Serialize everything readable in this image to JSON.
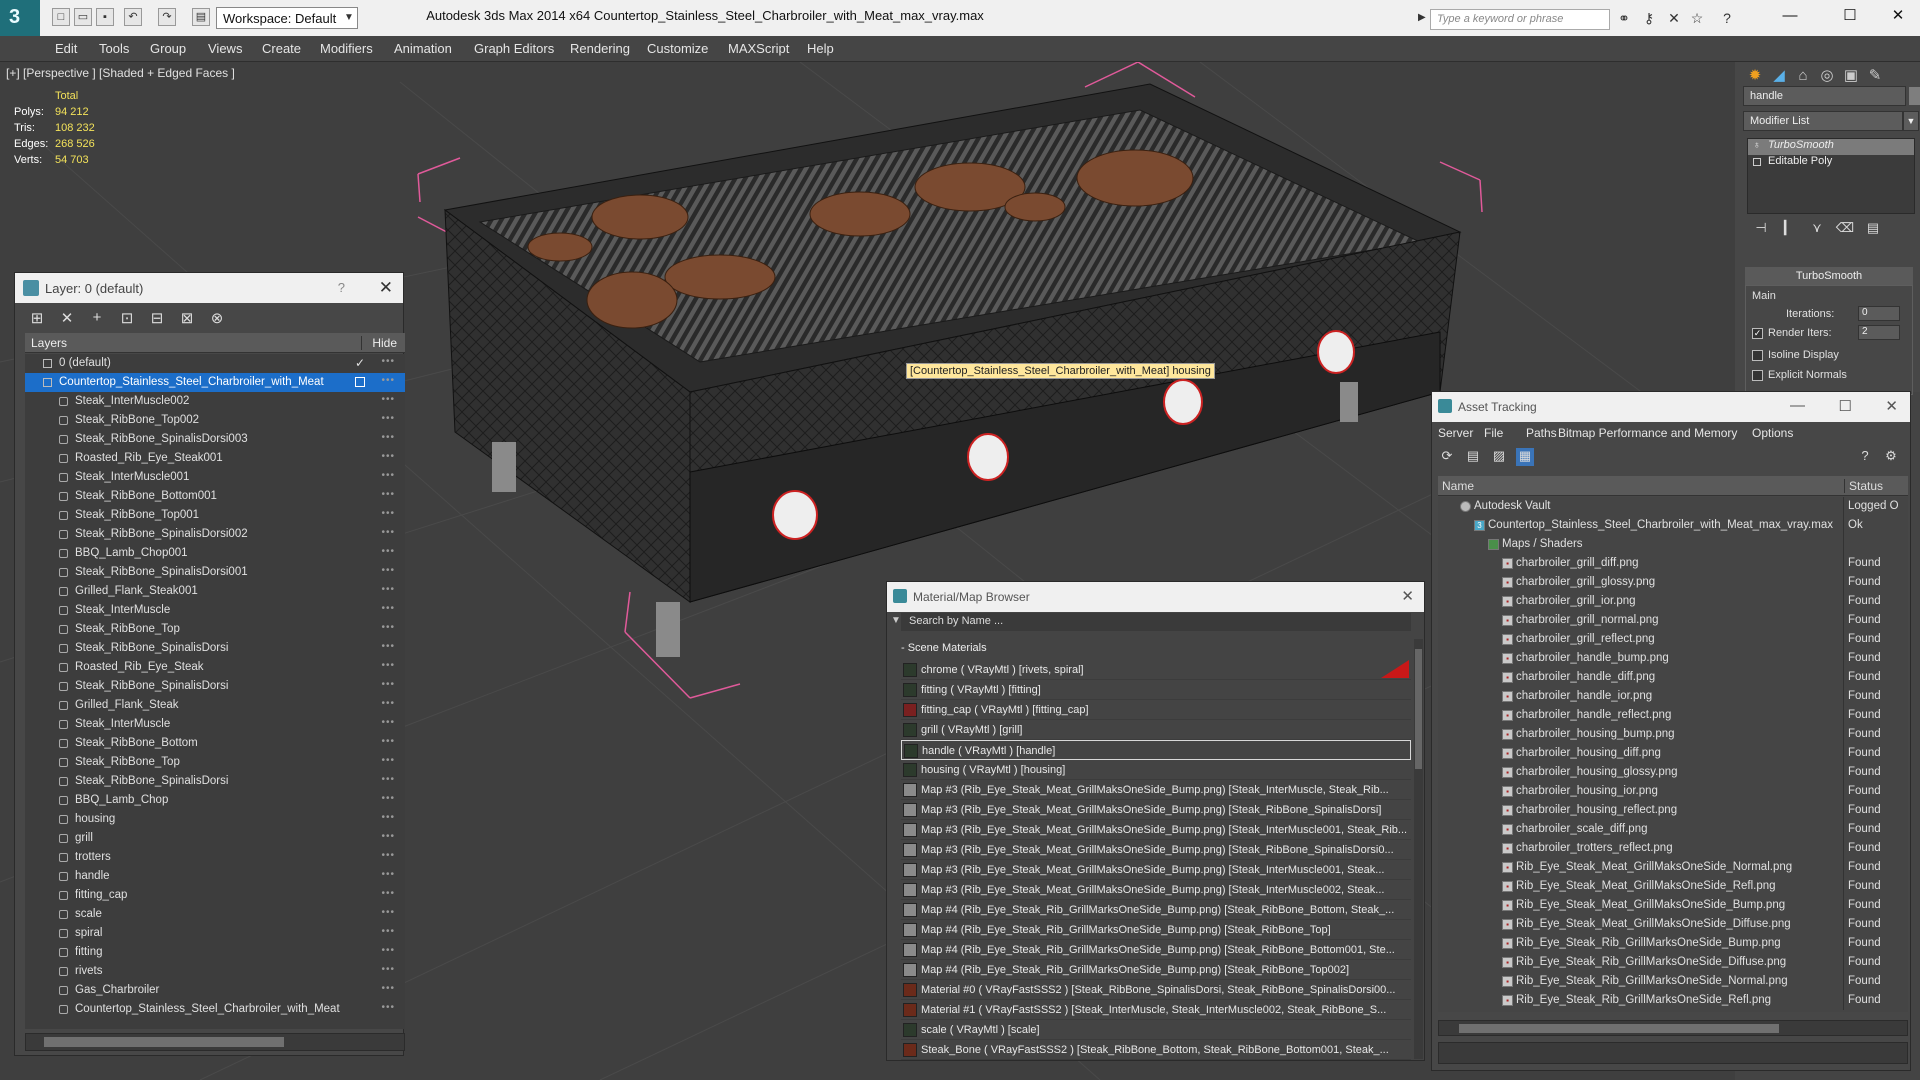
{
  "app": {
    "title": "Autodesk 3ds Max  2014 x64     Countertop_Stainless_Steel_Charbroiler_with_Meat_max_vray.max",
    "logo": "3",
    "workspace": "Workspace: Default",
    "search_placeholder": "Type a keyword or phrase",
    "win_minimize": "—",
    "win_maximize": "☐",
    "win_close": "✕"
  },
  "menu": [
    "Edit",
    "Tools",
    "Group",
    "Views",
    "Create",
    "Modifiers",
    "Animation",
    "Graph Editors",
    "Rendering",
    "Customize",
    "MAXScript",
    "Help"
  ],
  "viewport": {
    "label": "[+] [Perspective ] [Shaded + Edged Faces ]",
    "stats": {
      "header": "Total",
      "rows": [
        {
          "label": "Polys:",
          "value": "94 212"
        },
        {
          "label": "Tris:",
          "value": "108 232"
        },
        {
          "label": "Edges:",
          "value": "268 526"
        },
        {
          "label": "Verts:",
          "value": "54 703"
        }
      ]
    },
    "tooltip": "[Countertop_Stainless_Steel_Charbroiler_with_Meat] housing"
  },
  "layer_window": {
    "title": "Layer: 0 (default)",
    "help": "?",
    "close": "✕",
    "col_layers": "Layers",
    "col_hide": "Hide",
    "root": "0 (default)",
    "selected": "Countertop_Stainless_Steel_Charbroiler_with_Meat",
    "items": [
      "Steak_InterMuscle002",
      "Steak_RibBone_Top002",
      "Steak_RibBone_SpinalisDorsi003",
      "Roasted_Rib_Eye_Steak001",
      "Steak_InterMuscle001",
      "Steak_RibBone_Bottom001",
      "Steak_RibBone_Top001",
      "Steak_RibBone_SpinalisDorsi002",
      "BBQ_Lamb_Chop001",
      "Steak_RibBone_SpinalisDorsi001",
      "Grilled_Flank_Steak001",
      "Steak_InterMuscle",
      "Steak_RibBone_Top",
      "Steak_RibBone_SpinalisDorsi",
      "Roasted_Rib_Eye_Steak",
      "Steak_RibBone_SpinalisDorsi",
      "Grilled_Flank_Steak",
      "Steak_InterMuscle",
      "Steak_RibBone_Bottom",
      "Steak_RibBone_Top",
      "Steak_RibBone_SpinalisDorsi",
      "BBQ_Lamb_Chop",
      "housing",
      "grill",
      "trotters",
      "handle",
      "fitting_cap",
      "scale",
      "spiral",
      "fitting",
      "rivets",
      "Gas_Charbroiler",
      "Countertop_Stainless_Steel_Charbroiler_with_Meat"
    ]
  },
  "command_panel": {
    "object_name": "handle",
    "modifier_list": "Modifier List",
    "stack": [
      "TurboSmooth",
      "Editable Poly"
    ],
    "rollout_title": "TurboSmooth",
    "main_label": "Main",
    "iterations_label": "Iterations:",
    "iterations_value": "0",
    "render_iters_label": "Render Iters:",
    "render_iters_value": "2",
    "isoline_label": "Isoline Display",
    "explicit_normals_label": "Explicit Normals"
  },
  "material_browser": {
    "title": "Material/Map Browser",
    "close": "✕",
    "search_placeholder": "Search by Name ...",
    "category": "- Scene Materials",
    "items": [
      {
        "text": "chrome  ( VRayMtl ) [rivets, spiral]",
        "swatch": "#2c3a2c"
      },
      {
        "text": "fitting  ( VRayMtl ) [fitting]",
        "swatch": "#2c3a2c"
      },
      {
        "text": "fitting_cap  ( VRayMtl ) [fitting_cap]",
        "swatch": "#7a2020"
      },
      {
        "text": "grill  ( VRayMtl ) [grill]",
        "swatch": "#2c3a2c"
      },
      {
        "text": "handle  ( VRayMtl ) [handle]",
        "swatch": "#2c3a2c"
      },
      {
        "text": "housing  ( VRayMtl ) [housing]",
        "swatch": "#2c3a2c"
      },
      {
        "text": "Map #3 (Rib_Eye_Steak_Meat_GrillMaksOneSide_Bump.png) [Steak_InterMuscle, Steak_Rib...",
        "swatch": "#8a8a8a"
      },
      {
        "text": "Map #3 (Rib_Eye_Steak_Meat_GrillMaksOneSide_Bump.png) [Steak_RibBone_SpinalisDorsi]",
        "swatch": "#8a8a8a"
      },
      {
        "text": "Map #3 (Rib_Eye_Steak_Meat_GrillMaksOneSide_Bump.png) [Steak_InterMuscle001, Steak_Rib...",
        "swatch": "#8a8a8a"
      },
      {
        "text": "Map #3 (Rib_Eye_Steak_Meat_GrillMaksOneSide_Bump.png) [Steak_RibBone_SpinalisDorsi0...",
        "swatch": "#8a8a8a"
      },
      {
        "text": "Map #3 (Rib_Eye_Steak_Meat_GrillMaksOneSide_Bump.png) [Steak_InterMuscle001, Steak...",
        "swatch": "#8a8a8a"
      },
      {
        "text": "Map #3 (Rib_Eye_Steak_Meat_GrillMaksOneSide_Bump.png) [Steak_InterMuscle002, Steak...",
        "swatch": "#8a8a8a"
      },
      {
        "text": "Map #4 (Rib_Eye_Steak_Rib_GrillMarksOneSide_Bump.png) [Steak_RibBone_Bottom, Steak_...",
        "swatch": "#8a8a8a"
      },
      {
        "text": "Map #4 (Rib_Eye_Steak_Rib_GrillMarksOneSide_Bump.png) [Steak_RibBone_Top]",
        "swatch": "#8a8a8a"
      },
      {
        "text": "Map #4 (Rib_Eye_Steak_Rib_GrillMarksOneSide_Bump.png) [Steak_RibBone_Bottom001, Ste...",
        "swatch": "#8a8a8a"
      },
      {
        "text": "Map #4 (Rib_Eye_Steak_Rib_GrillMarksOneSide_Bump.png) [Steak_RibBone_Top002]",
        "swatch": "#8a8a8a"
      },
      {
        "text": "Material #0  ( VRayFastSSS2 ) [Steak_RibBone_SpinalisDorsi, Steak_RibBone_SpinalisDorsi00...",
        "swatch": "#6b2a1a"
      },
      {
        "text": "Material #1  ( VRayFastSSS2 ) [Steak_InterMuscle, Steak_InterMuscle002, Steak_RibBone_S...",
        "swatch": "#6b2a1a"
      },
      {
        "text": "scale  ( VRayMtl ) [scale]",
        "swatch": "#2c3a2c"
      },
      {
        "text": "Steak_Bone  ( VRayFastSSS2 ) [Steak_RibBone_Bottom, Steak_RibBone_Bottom001, Steak_...",
        "swatch": "#6b2a1a"
      }
    ]
  },
  "asset_tracking": {
    "title": "Asset Tracking",
    "menu": [
      "Server",
      "File",
      "Paths",
      "Bitmap Performance and Memory",
      "Options"
    ],
    "col_name": "Name",
    "col_status": "Status",
    "vault": {
      "name": "Autodesk Vault",
      "status": "Logged O"
    },
    "file": {
      "name": "Countertop_Stainless_Steel_Charbroiler_with_Meat_max_vray.max",
      "status": "Ok"
    },
    "group": "Maps / Shaders",
    "maps": [
      {
        "name": "charbroiler_grill_diff.png",
        "status": "Found"
      },
      {
        "name": "charbroiler_grill_glossy.png",
        "status": "Found"
      },
      {
        "name": "charbroiler_grill_ior.png",
        "status": "Found"
      },
      {
        "name": "charbroiler_grill_normal.png",
        "status": "Found"
      },
      {
        "name": "charbroiler_grill_reflect.png",
        "status": "Found"
      },
      {
        "name": "charbroiler_handle_bump.png",
        "status": "Found"
      },
      {
        "name": "charbroiler_handle_diff.png",
        "status": "Found"
      },
      {
        "name": "charbroiler_handle_ior.png",
        "status": "Found"
      },
      {
        "name": "charbroiler_handle_reflect.png",
        "status": "Found"
      },
      {
        "name": "charbroiler_housing_bump.png",
        "status": "Found"
      },
      {
        "name": "charbroiler_housing_diff.png",
        "status": "Found"
      },
      {
        "name": "charbroiler_housing_glossy.png",
        "status": "Found"
      },
      {
        "name": "charbroiler_housing_ior.png",
        "status": "Found"
      },
      {
        "name": "charbroiler_housing_reflect.png",
        "status": "Found"
      },
      {
        "name": "charbroiler_scale_diff.png",
        "status": "Found"
      },
      {
        "name": "charbroiler_trotters_reflect.png",
        "status": "Found"
      },
      {
        "name": "Rib_Eye_Steak_Meat_GrillMaksOneSide_Normal.png",
        "status": "Found"
      },
      {
        "name": "Rib_Eye_Steak_Meat_GrillMaksOneSide_Refl.png",
        "status": "Found"
      },
      {
        "name": "Rib_Eye_Steak_Meat_GrillMaksOneSide_Bump.png",
        "status": "Found"
      },
      {
        "name": "Rib_Eye_Steak_Meat_GrillMaksOneSide_Diffuse.png",
        "status": "Found"
      },
      {
        "name": "Rib_Eye_Steak_Rib_GrillMarksOneSide_Bump.png",
        "status": "Found"
      },
      {
        "name": "Rib_Eye_Steak_Rib_GrillMarksOneSide_Diffuse.png",
        "status": "Found"
      },
      {
        "name": "Rib_Eye_Steak_Rib_GrillMarksOneSide_Normal.png",
        "status": "Found"
      },
      {
        "name": "Rib_Eye_Steak_Rib_GrillMarksOneSide_Refl.png",
        "status": "Found"
      }
    ]
  },
  "colors": {
    "accent": "#1c6ec9",
    "stats_value": "#f3e25a",
    "tooltip_bg": "#ffe79c",
    "bbox_pink": "#e05a9a"
  }
}
